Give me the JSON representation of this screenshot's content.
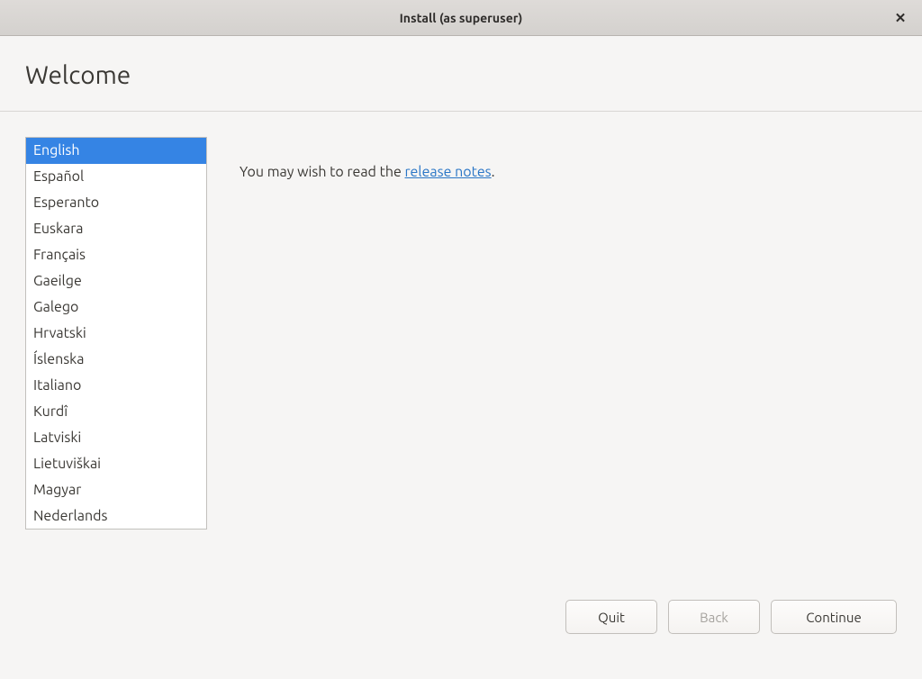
{
  "titlebar": {
    "title": "Install (as superuser)"
  },
  "header": {
    "page_title": "Welcome"
  },
  "languages": [
    {
      "label": "English",
      "selected": true
    },
    {
      "label": "Español",
      "selected": false
    },
    {
      "label": "Esperanto",
      "selected": false
    },
    {
      "label": "Euskara",
      "selected": false
    },
    {
      "label": "Français",
      "selected": false
    },
    {
      "label": "Gaeilge",
      "selected": false
    },
    {
      "label": "Galego",
      "selected": false
    },
    {
      "label": "Hrvatski",
      "selected": false
    },
    {
      "label": "Íslenska",
      "selected": false
    },
    {
      "label": "Italiano",
      "selected": false
    },
    {
      "label": "Kurdî",
      "selected": false
    },
    {
      "label": "Latviski",
      "selected": false
    },
    {
      "label": "Lietuviškai",
      "selected": false
    },
    {
      "label": "Magyar",
      "selected": false
    },
    {
      "label": "Nederlands",
      "selected": false
    }
  ],
  "info": {
    "prefix": "You may wish to read the ",
    "link_text": "release notes",
    "suffix": "."
  },
  "footer": {
    "quit": "Quit",
    "back": "Back",
    "continue": "Continue"
  }
}
